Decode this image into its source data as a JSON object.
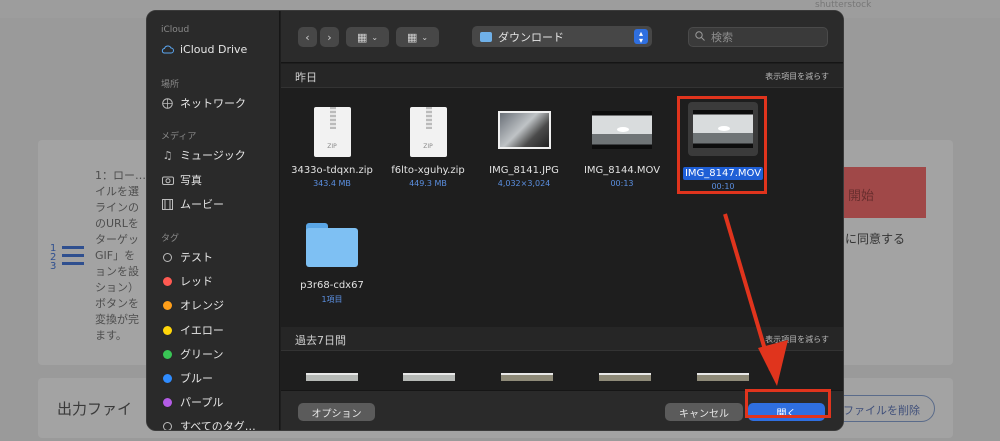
{
  "background": {
    "steps_text": "1：ロー…\nイルを選\nラインの\nのURLを\nターゲッ\nGIF」を\nョンを設\nション）\nボタンを\n変換が完\nます。",
    "start_label": "開始",
    "agree_text": "に同意する",
    "output_label": "出力ファイ",
    "delete_label": "ファイルを削除",
    "watermark": "shutterstock",
    "steps_icon_digits": "1\n2\n3"
  },
  "sidebar": {
    "icloud_header": "iCloud",
    "icloud_drive": "iCloud Drive",
    "places_header": "場所",
    "network": "ネットワーク",
    "media_header": "メディア",
    "music": "ミュージック",
    "photos": "写真",
    "movies": "ムービー",
    "tags_header": "タグ",
    "tags": [
      {
        "label": "テスト",
        "color": ""
      },
      {
        "label": "レッド",
        "color": "#ff5a52"
      },
      {
        "label": "オレンジ",
        "color": "#ff9f1a"
      },
      {
        "label": "イエロー",
        "color": "#ffd60a"
      },
      {
        "label": "グリーン",
        "color": "#39c555"
      },
      {
        "label": "ブルー",
        "color": "#2f8cff"
      },
      {
        "label": "パープル",
        "color": "#b45ce6"
      },
      {
        "label": "すべてのタグ…",
        "color": ""
      }
    ]
  },
  "toolbar": {
    "location": "ダウンロード",
    "search_placeholder": "検索"
  },
  "sections": {
    "yesterday": "昨日",
    "last7": "過去7日間",
    "show_less": "表示項目を減らす"
  },
  "files": [
    {
      "name": "3433o-tdqxn.zip",
      "meta": "343.4 MB",
      "kind": "zip",
      "zip_label": "ZIP"
    },
    {
      "name": "f6lto-xguhy.zip",
      "meta": "449.3 MB",
      "kind": "zip",
      "zip_label": "ZIP"
    },
    {
      "name": "IMG_8141.JPG",
      "meta": "4,032×3,024",
      "kind": "photo"
    },
    {
      "name": "IMG_8144.MOV",
      "meta": "00:13",
      "kind": "video"
    },
    {
      "name": "IMG_8147.MOV",
      "meta": "00:10",
      "kind": "video",
      "selected": true
    },
    {
      "name": "p3r68-cdx67",
      "meta": "1項目",
      "kind": "folder"
    }
  ],
  "buttons": {
    "options": "オプション",
    "cancel": "キャンセル",
    "open": "開く"
  },
  "colors": {
    "accent": "#2f6fe0",
    "annotation": "#e0341d"
  }
}
